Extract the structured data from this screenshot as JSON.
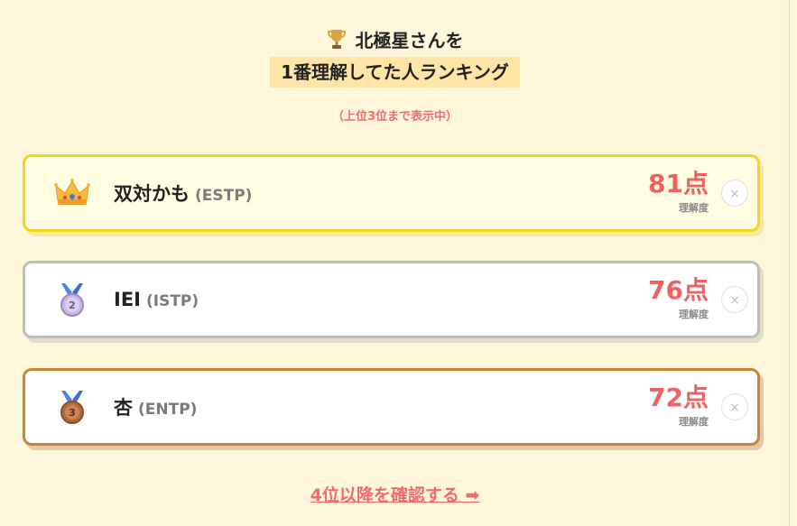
{
  "title": {
    "line1": "北極星さんを",
    "line2": "1番理解してた人ランキング",
    "icon": "trophy-icon"
  },
  "subtitle": "（上位3位まで表示中）",
  "ranking": [
    {
      "rank": 1,
      "icon": "crown-icon",
      "name": "双対かも",
      "mbti": "(ESTP)",
      "score": "81点",
      "score_label": "理解度"
    },
    {
      "rank": 2,
      "icon": "silver-medal-icon",
      "medal_number": "2",
      "name": "IEI",
      "mbti": "(ISTP)",
      "score": "76点",
      "score_label": "理解度"
    },
    {
      "rank": 3,
      "icon": "bronze-medal-icon",
      "medal_number": "3",
      "name": "杏",
      "mbti": "(ENTP)",
      "score": "72点",
      "score_label": "理解度"
    }
  ],
  "close_label": "×",
  "more_link": "4位以降を確認する ➡",
  "colors": {
    "background": "#fff7dc",
    "accent": "#f06262",
    "gold": "#f7d51c",
    "silver": "#bdbdbd",
    "bronze": "#cd8337"
  }
}
